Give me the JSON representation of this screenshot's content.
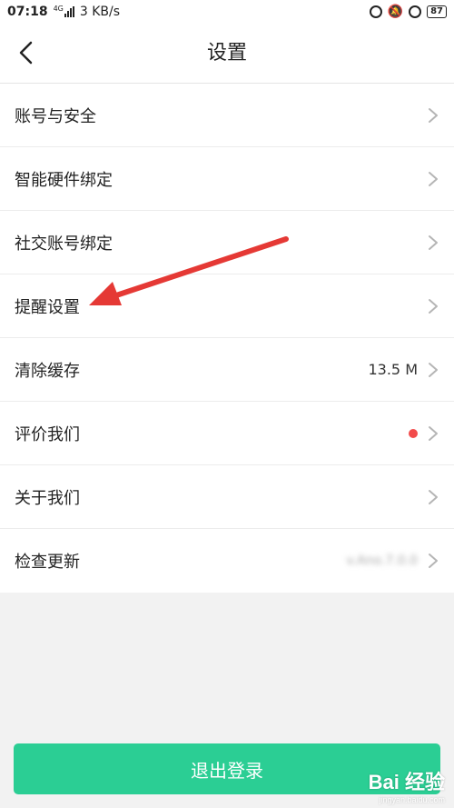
{
  "status_bar": {
    "time": "07:18",
    "network": "4G",
    "speed": "3 KB/s",
    "battery": "87"
  },
  "header": {
    "title": "设置"
  },
  "settings": {
    "items": [
      {
        "label": "账号与安全"
      },
      {
        "label": "智能硬件绑定"
      },
      {
        "label": "社交账号绑定"
      },
      {
        "label": "提醒设置"
      },
      {
        "label": "清除缓存",
        "value": "13.5 M"
      },
      {
        "label": "评价我们"
      },
      {
        "label": "关于我们"
      },
      {
        "label": "检查更新",
        "value": "v.Ano.7.0.0"
      }
    ]
  },
  "logout": {
    "label": "退出登录"
  },
  "watermark": {
    "brand": "Bai 经验",
    "url": "jingyan.baidu.com"
  },
  "colors": {
    "accent": "#2bce94",
    "annotation_arrow": "#e53935",
    "badge_dot": "#f24b4b"
  }
}
